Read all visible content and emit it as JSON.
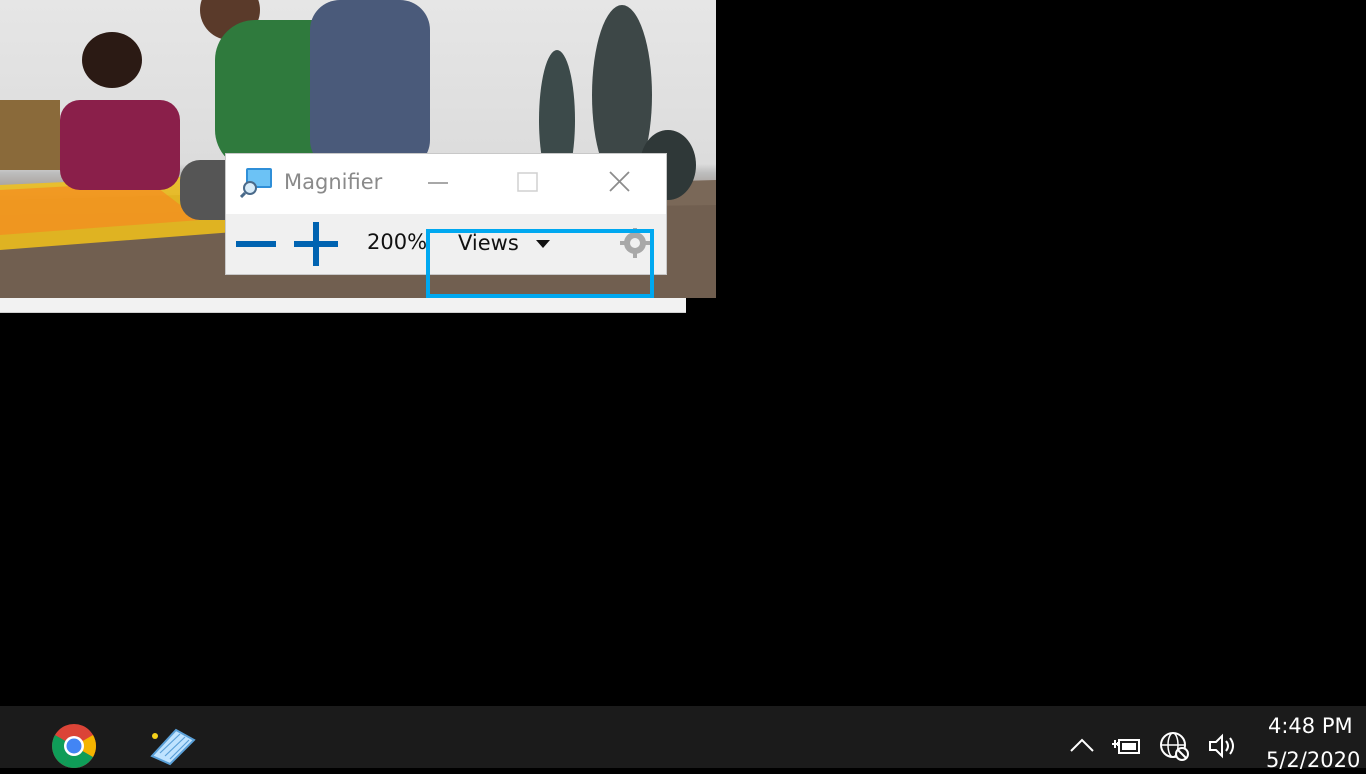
{
  "magnifier": {
    "title": "Magnifier",
    "zoom_level": "200%",
    "views_label": "Views"
  },
  "taskbar": {
    "clock_time": "4:48 PM",
    "clock_date": "5/2/2020"
  },
  "icons": {
    "app": "magnifier-icon",
    "minimize": "minimize-icon",
    "maximize": "maximize-icon",
    "close": "close-icon",
    "zoom_out": "minus-icon",
    "zoom_in": "plus-icon",
    "settings": "gear-icon",
    "chrome": "chrome-icon",
    "osk": "on-screen-keyboard-icon",
    "tray": [
      "chevron-up-icon",
      "power-icon",
      "network-icon",
      "volume-icon"
    ]
  },
  "colors": {
    "accent_blue": "#0063b1",
    "highlight": "#00a8f0",
    "taskbar": "#1b1b1b"
  }
}
